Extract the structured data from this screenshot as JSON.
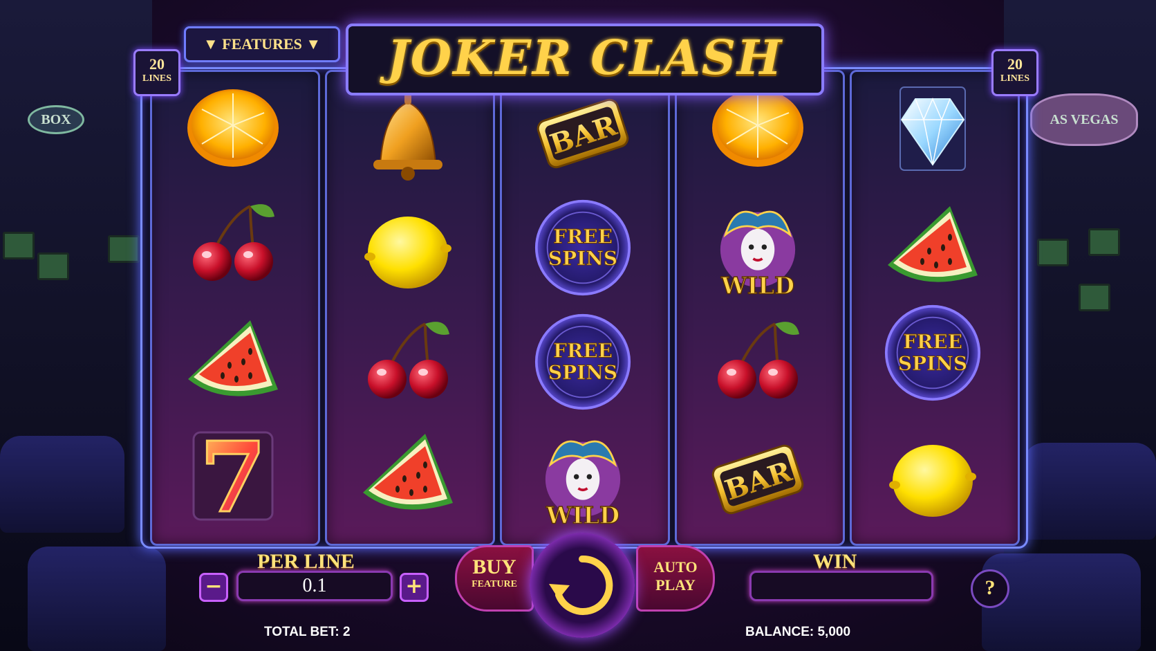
{
  "header": {
    "features_label": "▼ FEATURES ▼",
    "title": "JOKER CLASH",
    "lines_left": {
      "count": "20",
      "label": "LINES"
    },
    "lines_right": {
      "count": "20",
      "label": "LINES"
    }
  },
  "background": {
    "sign_left": "BOX",
    "sign_right": "AS VEGAS"
  },
  "reels": [
    [
      "orange-icon",
      "cherry-icon",
      "watermelon-icon",
      "seven-icon"
    ],
    [
      "bell-icon",
      "lemon-icon",
      "cherry-icon",
      "watermelon-icon"
    ],
    [
      "bar-icon",
      "free-spins-icon",
      "free-spins-icon",
      "wild-joker-icon"
    ],
    [
      "orange-icon",
      "wild-joker-icon",
      "cherry-icon",
      "bar-icon"
    ],
    [
      "diamond-icon",
      "watermelon-icon",
      "free-spins-icon",
      "lemon-icon"
    ]
  ],
  "symbol_text": {
    "bar": "BAR",
    "free": "FREE",
    "spins": "SPINS",
    "wild": "WILD",
    "seven": "7"
  },
  "controls": {
    "per_line_label": "PER LINE",
    "per_line_value": "0.1",
    "minus": "−",
    "plus": "+",
    "buy_feature_line1": "BUY",
    "buy_feature_line2": "FEATURE",
    "auto_play_line1": "AUTO",
    "auto_play_line2": "PLAY",
    "win_label": "WIN",
    "win_value": "",
    "help": "?",
    "total_bet": "TOTAL BET: 2",
    "balance": "BALANCE: 5,000"
  },
  "colors": {
    "gold": "#ffd24a",
    "frame": "#7a8cff",
    "accent_purple": "#c040c0"
  }
}
